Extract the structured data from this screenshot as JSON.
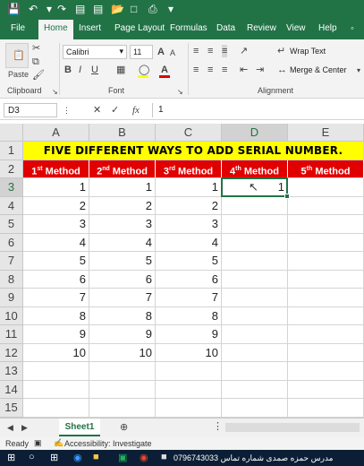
{
  "menu": {
    "tabs": [
      "File",
      "Home",
      "Insert",
      "Page Layout",
      "Formulas",
      "Data",
      "Review",
      "View",
      "Help"
    ],
    "active": "Home"
  },
  "ribbon": {
    "paste_label": "Paste",
    "clipboard_label": "Clipboard",
    "font_label": "Font",
    "alignment_label": "Alignment",
    "font_name": "Calibri",
    "font_size": "11",
    "bold": "B",
    "italic": "I",
    "underline": "U",
    "grow_font": "A",
    "shrink_font": "A",
    "wrap_text": "Wrap Text",
    "merge_center": "Merge & Center"
  },
  "formula_bar": {
    "name_box": "D3",
    "fx_label": "fx",
    "formula": "1"
  },
  "grid": {
    "columns": [
      "A",
      "B",
      "C",
      "D",
      "E"
    ],
    "rows": [
      "1",
      "2",
      "3",
      "4",
      "5",
      "6",
      "7",
      "8",
      "9",
      "10",
      "11",
      "12",
      "13",
      "14",
      "15"
    ],
    "title": "FIVE DIFFERENT WAYS TO ADD SERIAL NUMBER.",
    "method_headers": [
      {
        "num": "1",
        "sup": "st",
        "label": " Method"
      },
      {
        "num": "2",
        "sup": "nd",
        "label": " Method"
      },
      {
        "num": "3",
        "sup": "rd",
        "label": " Method"
      },
      {
        "num": "4",
        "sup": "th",
        "label": " Method"
      },
      {
        "num": "5",
        "sup": "th",
        "label": " Method"
      }
    ],
    "col_a": [
      "1",
      "2",
      "3",
      "4",
      "5",
      "6",
      "7",
      "8",
      "9",
      "10"
    ],
    "col_b": [
      "1",
      "2",
      "3",
      "4",
      "5",
      "6",
      "7",
      "8",
      "9",
      "10"
    ],
    "col_c": [
      "1",
      "2",
      "3",
      "4",
      "5",
      "6",
      "7",
      "8",
      "9",
      "10"
    ],
    "col_d": [
      "1"
    ]
  },
  "sheet_tab": "Sheet1",
  "status": {
    "ready": "Ready",
    "accessibility": "Accessibility: Investigate"
  },
  "taskbar": {
    "text": "مدرس حمزه صمدى  شماره تماس 0796743033"
  },
  "colors": {
    "excel_green": "#217346",
    "header_red": "#e00000",
    "title_yellow": "#ffff00"
  }
}
